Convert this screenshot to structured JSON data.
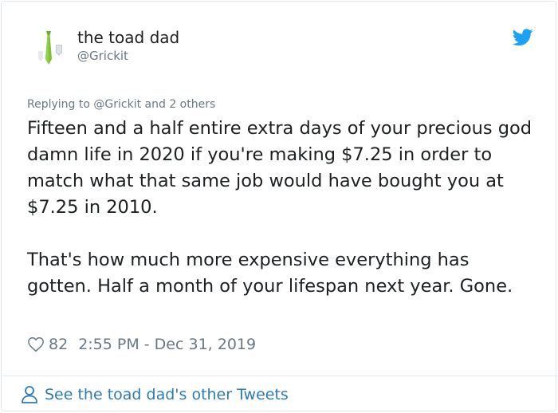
{
  "tweet": {
    "author_name": "the toad dad",
    "author_handle": "@Grickit",
    "reply_prefix": "Replying to",
    "reply_mention": "@Grickit",
    "reply_suffix": "and 2 others",
    "text": "Fifteen and a half entire extra days of your precious god damn life in 2020 if you're making $7.25 in order to match what that same job would have bought you at $7.25 in 2010.\n\nThat's how much more expensive everything has gotten. Half a month of your lifespan next year. Gone.",
    "likes": "82",
    "timestamp": "2:55 PM - Dec 31, 2019"
  },
  "footer": {
    "label": "See the toad dad's other Tweets"
  },
  "icons": {
    "avatar": "tie-avatar",
    "brand": "twitter-bird-icon",
    "like": "heart-icon",
    "profile": "person-icon"
  },
  "colors": {
    "brand_blue": "#1da1f2",
    "link_blue": "#2b7bb9",
    "secondary_text": "#697882",
    "primary_text": "#1c2022",
    "border": "#e1e8ed"
  }
}
